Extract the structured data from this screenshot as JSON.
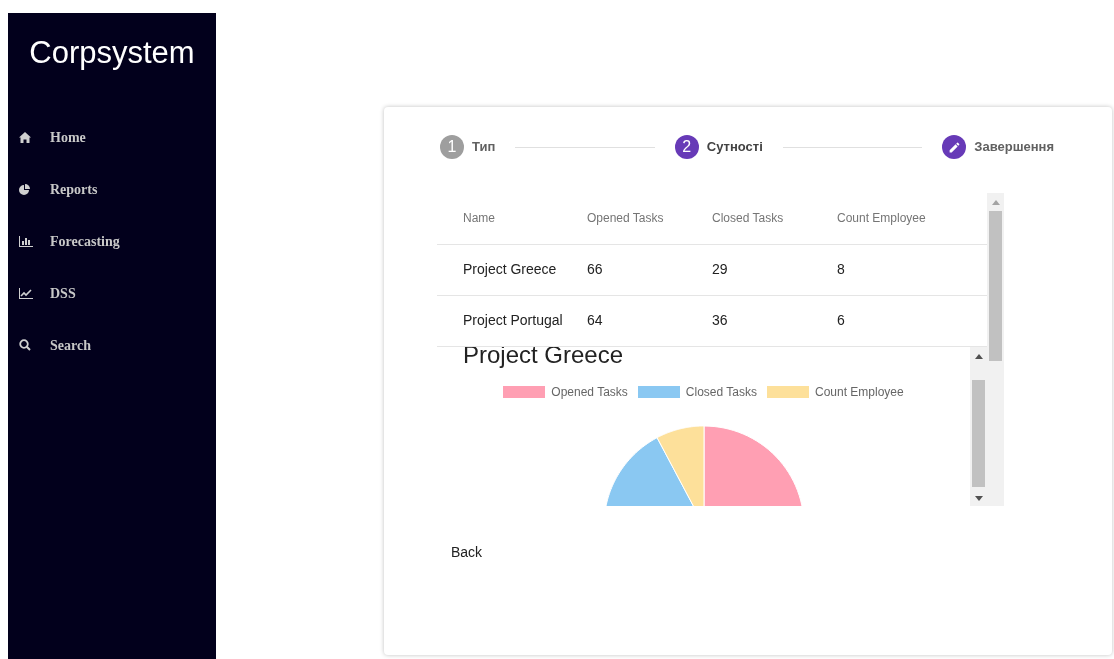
{
  "sidebar": {
    "brand": "Corpsystem",
    "items": [
      {
        "label": "Home"
      },
      {
        "label": "Reports"
      },
      {
        "label": "Forecasting"
      },
      {
        "label": "DSS"
      },
      {
        "label": "Search"
      }
    ]
  },
  "stepper": [
    {
      "number": "1",
      "label": "Тип",
      "active": false,
      "editable": false
    },
    {
      "number": "2",
      "label": "Сутності",
      "active": true,
      "editable": false
    },
    {
      "label": "Завершення",
      "active": false,
      "editable": true
    }
  ],
  "table": {
    "columns": [
      "Name",
      "Opened Tasks",
      "Closed Tasks",
      "Count Employee"
    ],
    "rows": [
      [
        "Project Greece",
        "66",
        "29",
        "8"
      ],
      [
        "Project Portugal",
        "64",
        "36",
        "6"
      ]
    ]
  },
  "chart": {
    "title": "Project Greece",
    "legend": [
      {
        "label": "Opened Tasks",
        "color": "#ff9fb3"
      },
      {
        "label": "Closed Tasks",
        "color": "#8ac8f2"
      },
      {
        "label": "Count Employee",
        "color": "#fde09a"
      }
    ]
  },
  "back_button": "Back"
}
